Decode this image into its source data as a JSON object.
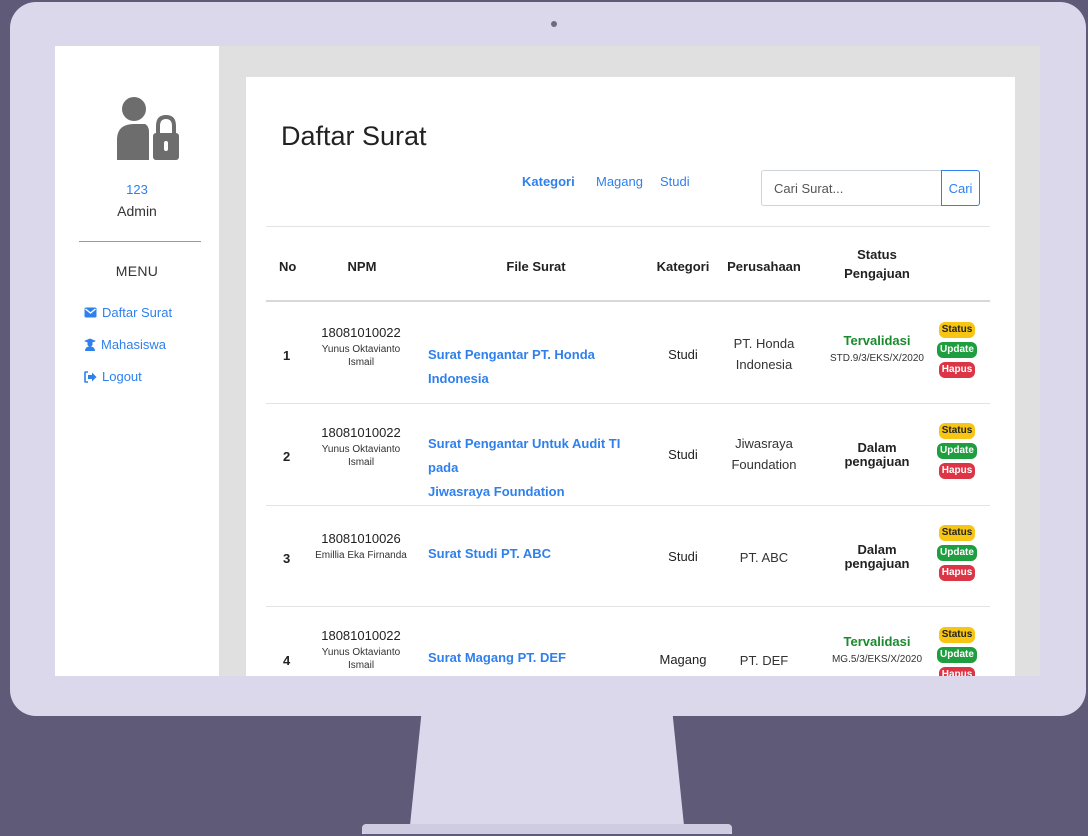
{
  "sidebar": {
    "user_id": "123",
    "user_role": "Admin",
    "menu_title": "MENU",
    "items": [
      {
        "label": "Daftar Surat",
        "icon": "envelope-icon"
      },
      {
        "label": "Mahasiswa",
        "icon": "student-icon"
      },
      {
        "label": "Logout",
        "icon": "logout-icon"
      }
    ]
  },
  "main": {
    "title": "Daftar Surat",
    "tabs": [
      "Kategori",
      "Magang",
      "Studi"
    ],
    "search": {
      "placeholder": "Cari Surat...",
      "button": "Cari"
    },
    "headers": {
      "no": "No",
      "npm": "NPM",
      "file": "File Surat",
      "kategori": "Kategori",
      "perusahaan": "Perusahaan",
      "status_line1": "Status",
      "status_line2": "Pengajuan"
    },
    "actions": {
      "status": "Status",
      "update": "Update",
      "hapus": "Hapus"
    },
    "rows": [
      {
        "no": "1",
        "npm": "18081010022",
        "name_line1": "Yunus Oktavianto",
        "name_line2": "Ismail",
        "file": "Surat Pengantar PT. Honda Indonesia",
        "kategori": "Studi",
        "perusahaan_line1": "PT. Honda",
        "perusahaan_line2": "Indonesia",
        "status": "Tervalidasi",
        "status_code": "STD.9/3/EKS/X/2020"
      },
      {
        "no": "2",
        "npm": "18081010022",
        "name_line1": "Yunus Oktavianto",
        "name_line2": "Ismail",
        "file_line1": "Surat Pengantar Untuk Audit TI pada",
        "file_line2": "Jiwasraya Foundation",
        "kategori": "Studi",
        "perusahaan_line1": "Jiwasraya",
        "perusahaan_line2": "Foundation",
        "status_line1": "Dalam",
        "status_line2": "pengajuan"
      },
      {
        "no": "3",
        "npm": "18081010026",
        "name_line1": "Emillia Eka Firnanda",
        "file": "Surat Studi PT. ABC",
        "kategori": "Studi",
        "perusahaan": "PT. ABC",
        "status_line1": "Dalam",
        "status_line2": "pengajuan"
      },
      {
        "no": "4",
        "npm": "18081010022",
        "name_line1": "Yunus Oktavianto",
        "name_line2": "Ismail",
        "file": "Surat Magang PT. DEF",
        "kategori": "Magang",
        "perusahaan": "PT. DEF",
        "status": "Tervalidasi",
        "status_code": "MG.5/3/EKS/X/2020"
      }
    ]
  }
}
